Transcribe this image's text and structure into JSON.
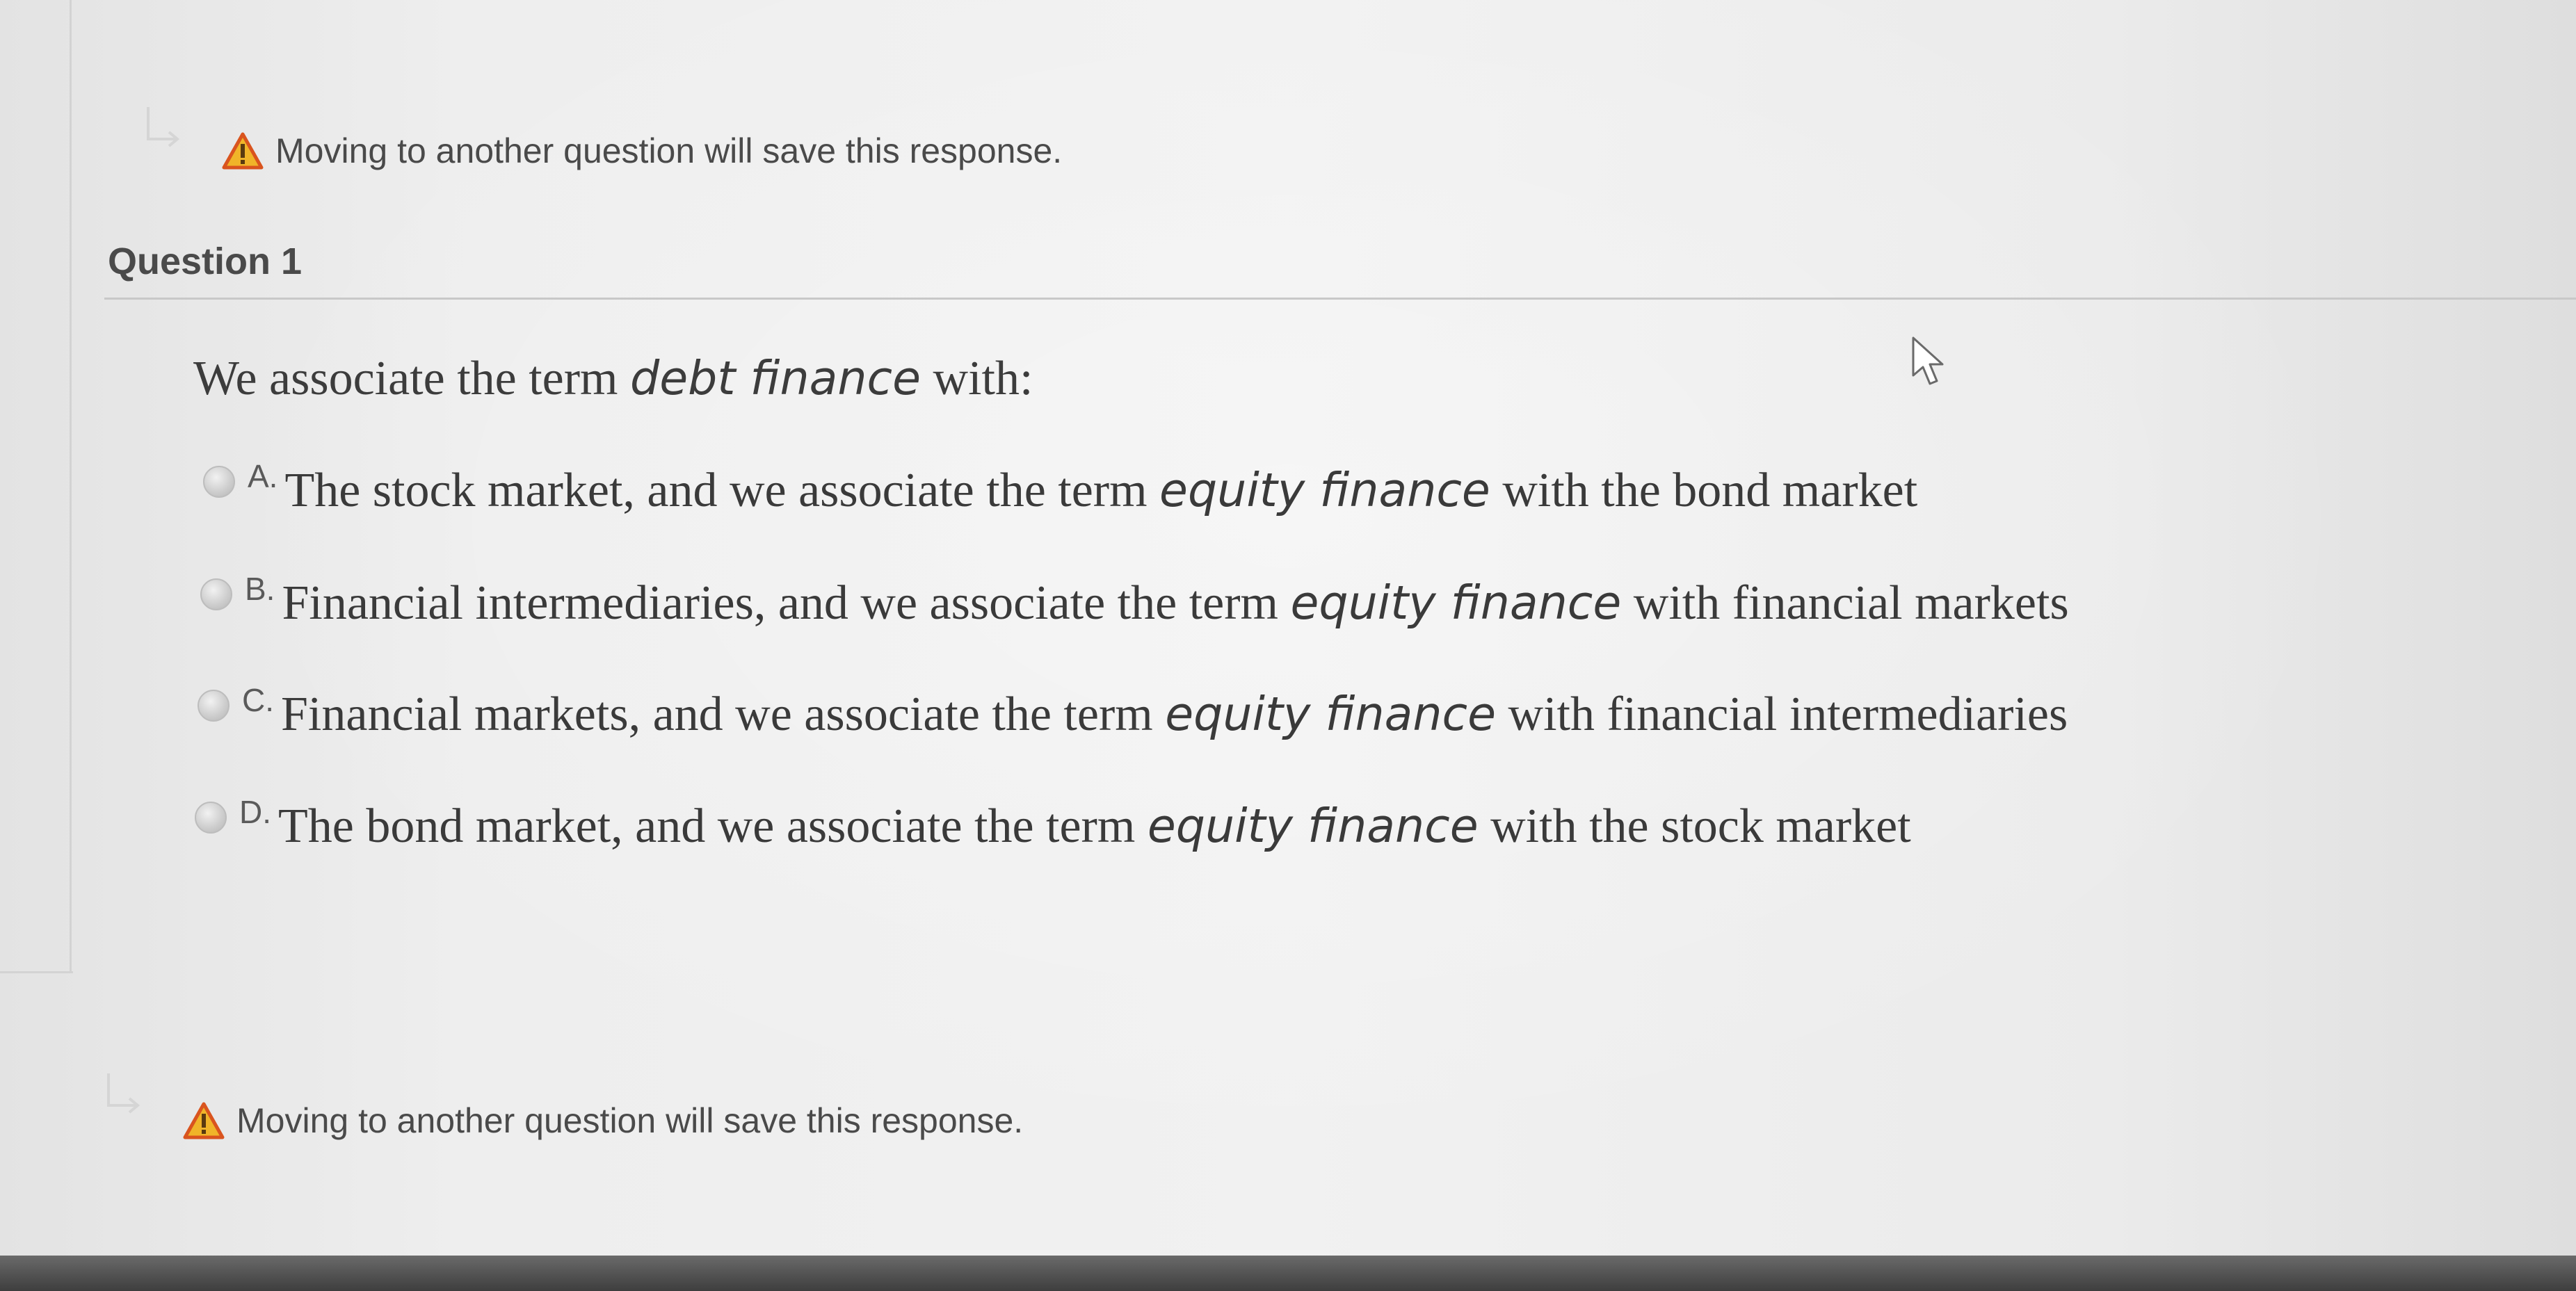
{
  "notices": {
    "top": "Moving to another question will save this response.",
    "bottom": "Moving to another question will save this response."
  },
  "question": {
    "title": "Question 1",
    "prompt_before": "We associate the term ",
    "prompt_emphasis": "debt finance",
    "prompt_after": " with:",
    "choices": [
      {
        "letter": "A.",
        "before": "The stock market, and we associate the term ",
        "emphasis": "equity finance",
        "after": " with the bond market"
      },
      {
        "letter": "B.",
        "before": "Financial intermediaries, and we associate the term ",
        "emphasis": "equity finance",
        "after": " with financial markets"
      },
      {
        "letter": "C.",
        "before": "Financial markets, and we associate the term ",
        "emphasis": "equity finance",
        "after": " with financial intermediaries"
      },
      {
        "letter": "D.",
        "before": "The bond market, and we associate the term ",
        "emphasis": "equity finance",
        "after": " with the stock market"
      }
    ],
    "selected": null
  },
  "icons": {
    "notice_arrow": "return-arrow-icon",
    "warning": "warning-triangle-icon",
    "cursor": "mouse-pointer-icon",
    "radio": "radio-button-icon"
  },
  "colors": {
    "warning_fill": "#f0b429",
    "warning_stroke": "#d9541e",
    "text": "#3a3a3a"
  }
}
